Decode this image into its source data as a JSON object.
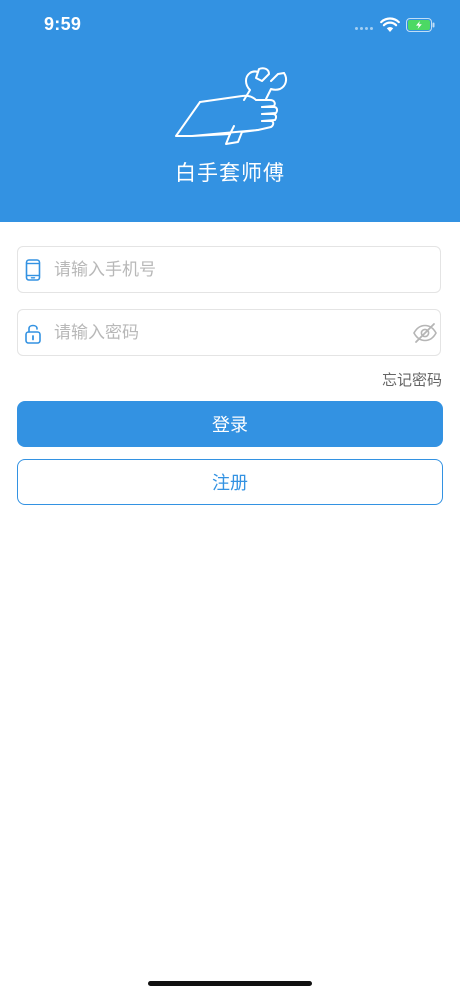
{
  "status_bar": {
    "time": "9:59"
  },
  "header": {
    "app_title": "白手套师傅",
    "logo_icon": "wrench-hand-icon"
  },
  "form": {
    "phone": {
      "placeholder": "请输入手机号",
      "value": "",
      "icon": "phone-icon"
    },
    "password": {
      "placeholder": "请输入密码",
      "value": "",
      "icon": "lock-icon",
      "toggle_icon": "eye-off-icon"
    },
    "forgot_password_label": "忘记密码"
  },
  "buttons": {
    "login_label": "登录",
    "register_label": "注册"
  },
  "colors": {
    "primary": "#3392e2",
    "background": "#ffffff",
    "placeholder": "#b8b8b8",
    "border": "#e4e4e4",
    "battery": "#4cd964"
  }
}
